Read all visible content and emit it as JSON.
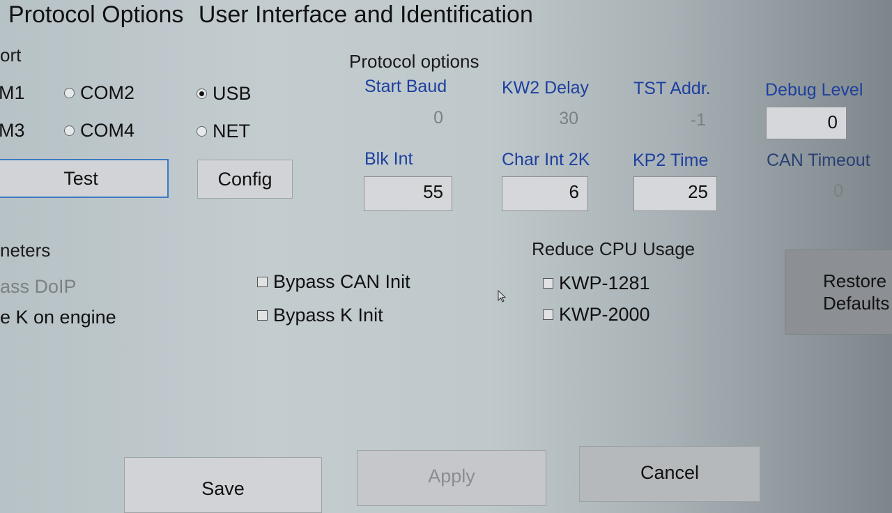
{
  "tabs": [
    "Protocol Options",
    "User Interface and Identification"
  ],
  "port_group": {
    "label": "ort",
    "radios": [
      {
        "label": "M1",
        "selected": false
      },
      {
        "label": "COM2",
        "selected": false
      },
      {
        "label": "USB",
        "selected": true
      },
      {
        "label": "M3",
        "selected": false
      },
      {
        "label": "COM4",
        "selected": false
      },
      {
        "label": "NET",
        "selected": false
      }
    ],
    "test_button": "Test",
    "config_button": "Config"
  },
  "protocol_options": {
    "label": "Protocol options",
    "fields": [
      {
        "label": "Start Baud",
        "value": "0",
        "editable": false
      },
      {
        "label": "KW2 Delay",
        "value": "30",
        "editable": false
      },
      {
        "label": "TST Addr.",
        "value": "-1",
        "editable": false
      },
      {
        "label": "Debug Level",
        "value": "0",
        "editable": true
      },
      {
        "label": "Blk Int",
        "value": "55",
        "editable": true
      },
      {
        "label": "Char Int 2K",
        "value": "6",
        "editable": true
      },
      {
        "label": "KP2 Time",
        "value": "25",
        "editable": true
      },
      {
        "label": "CAN Timeout",
        "value": "0",
        "editable": false
      }
    ]
  },
  "parameters": {
    "label": "neters",
    "items": [
      {
        "label": "ass DoIP",
        "disabled": true
      },
      {
        "label": "e K on engine",
        "disabled": false
      }
    ],
    "checkboxes": [
      {
        "label": "Bypass CAN Init",
        "checked": false
      },
      {
        "label": "Bypass K Init",
        "checked": false
      }
    ]
  },
  "reduce_cpu": {
    "label": "Reduce CPU Usage",
    "checkboxes": [
      {
        "label": "KWP-1281",
        "checked": false
      },
      {
        "label": "KWP-2000",
        "checked": false
      }
    ]
  },
  "restore_defaults": {
    "line1": "Restore",
    "line2": "Defaults"
  },
  "footer": {
    "save": "Save",
    "apply": "Apply",
    "cancel": "Cancel"
  }
}
